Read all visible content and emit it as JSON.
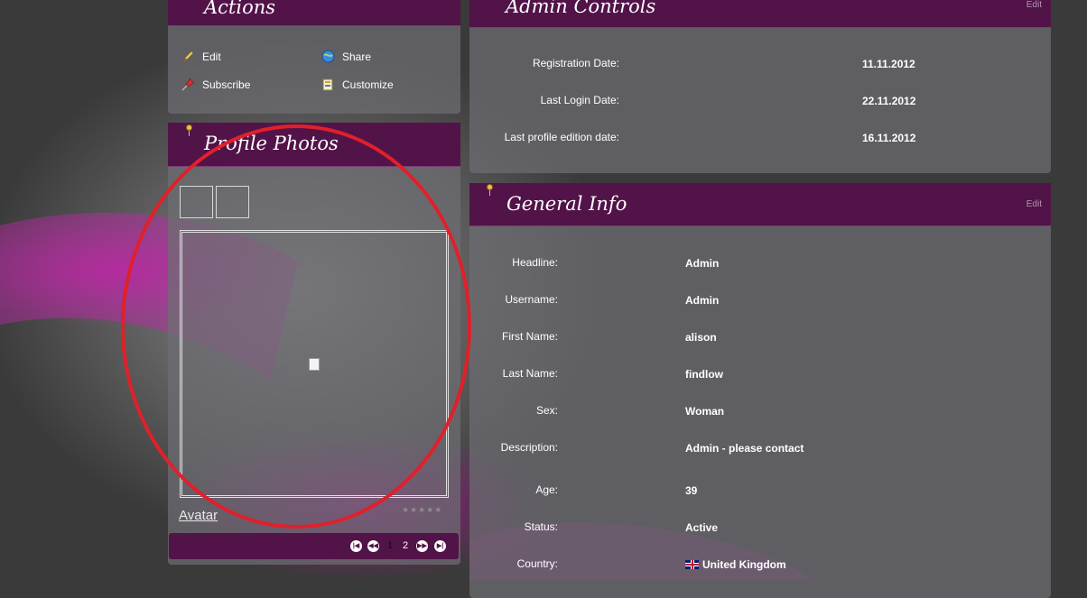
{
  "colors": {
    "header": "#521349",
    "panel": "rgba(110,110,115,0.72)",
    "highlight": "#e0202a"
  },
  "actions": {
    "title": "Actions",
    "items": [
      {
        "label": "Edit",
        "icon": "pencil-icon"
      },
      {
        "label": "Share",
        "icon": "globe-icon"
      },
      {
        "label": "Subscribe",
        "icon": "pushpin-icon"
      },
      {
        "label": "Customize",
        "icon": "customize-icon"
      }
    ]
  },
  "photos": {
    "title": "Profile Photos",
    "caption": "Avatar",
    "rating_stars": 5,
    "pager": {
      "current": "1",
      "next": "2"
    }
  },
  "admin": {
    "title": "Admin Controls",
    "edit_label": "Edit",
    "rows": [
      {
        "label": "Registration Date:",
        "value": "11.11.2012"
      },
      {
        "label": "Last Login Date:",
        "value": "22.11.2012"
      },
      {
        "label": "Last profile edition date:",
        "value": "16.11.2012"
      }
    ]
  },
  "general": {
    "title": "General Info",
    "edit_label": "Edit",
    "rows": [
      {
        "label": "Headline:",
        "value": "Admin"
      },
      {
        "label": "Username:",
        "value": "Admin"
      },
      {
        "label": "First Name:",
        "value": "alison"
      },
      {
        "label": "Last Name:",
        "value": "findlow"
      },
      {
        "label": "Sex:",
        "value": "Woman"
      },
      {
        "label": "Description:",
        "value": "Admin - please contact"
      },
      {
        "label": "Age:",
        "value": "39"
      },
      {
        "label": "Status:",
        "value": "Active"
      },
      {
        "label": "Country:",
        "value": "United Kingdom",
        "icon": "uk-flag-icon"
      }
    ]
  }
}
